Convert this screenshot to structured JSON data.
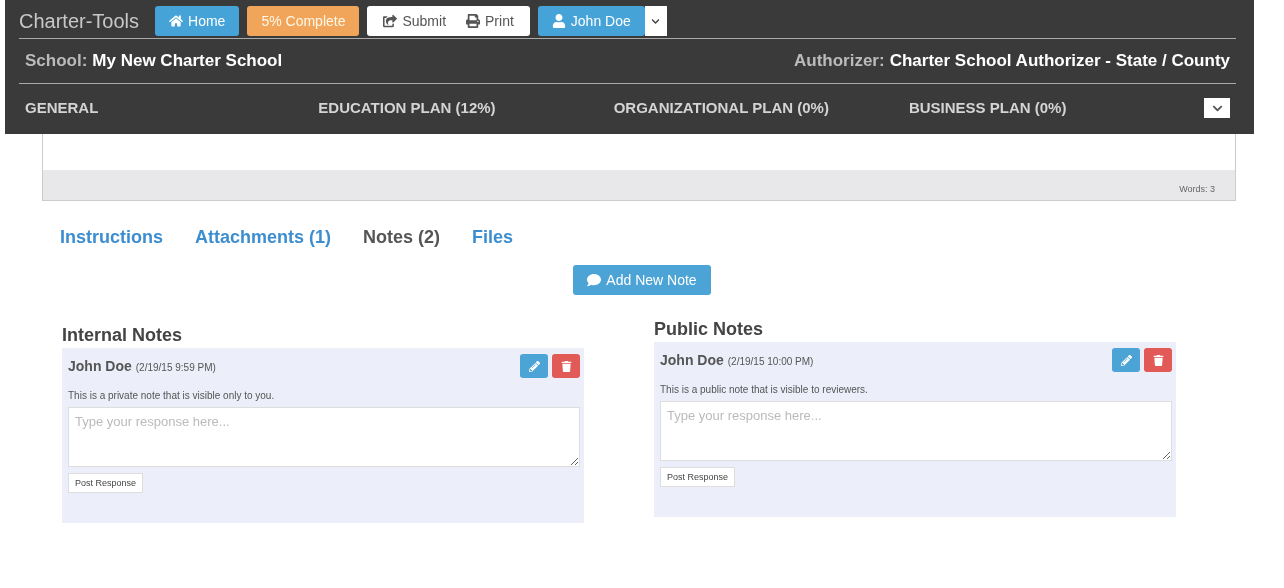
{
  "header": {
    "brand": "Charter-Tools",
    "toolbar": [
      {
        "kind": "home",
        "label": "Home"
      },
      {
        "kind": "progress",
        "label": "5% Complete"
      },
      {
        "kind": "submit",
        "label": "Submit"
      },
      {
        "kind": "print",
        "label": "Print"
      },
      {
        "kind": "user",
        "label": "John Doe"
      }
    ],
    "school_label": "School:",
    "school_name": "My New Charter School",
    "authorizer_label": "Authorizer:",
    "authorizer_name": "Charter School Authorizer - State / County",
    "plan_tabs": [
      "GENERAL",
      "EDUCATION PLAN (12%)",
      "ORGANIZATIONAL PLAN (0%)",
      "BUSINESS PLAN (0%)"
    ]
  },
  "editor": {
    "word_count": "Words: 3"
  },
  "tabs": [
    {
      "label": "Instructions",
      "selected": false
    },
    {
      "label": "Attachments (1)",
      "selected": false
    },
    {
      "label": "Notes (2)",
      "selected": true
    },
    {
      "label": "Files",
      "selected": false
    }
  ],
  "add_note_button": "Add New Note",
  "note_sections": [
    {
      "title": "Internal Notes",
      "author": "John Doe",
      "time": "(2/19/15 9:59 PM)",
      "text": "This is a private note that is visible only to you.",
      "placeholder": "Type your response here...",
      "button": "Post Response"
    },
    {
      "title": "Public Notes",
      "author": "John Doe",
      "time": "(2/19/15 10:00 PM)",
      "text": "This is a public note that is visible to reviewers.",
      "placeholder": "Type your response here...",
      "button": "Post Response"
    }
  ]
}
